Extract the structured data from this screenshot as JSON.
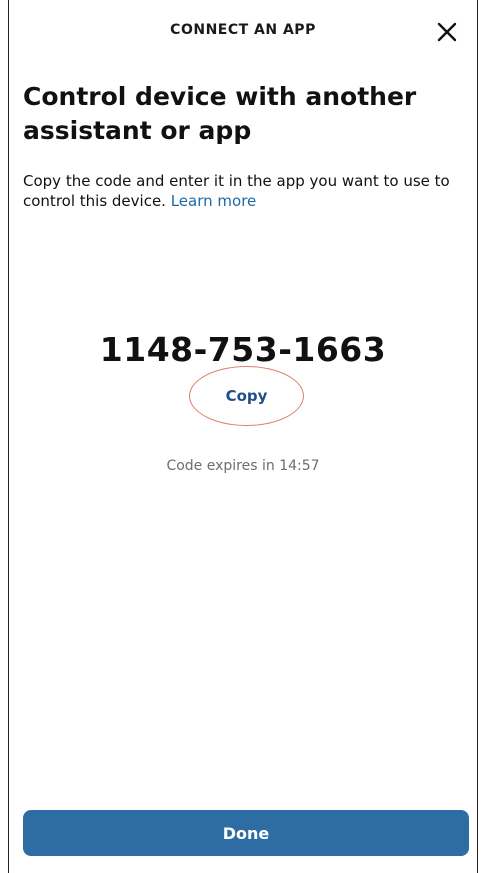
{
  "header": {
    "title": "CONNECT AN APP",
    "close_icon": "close-icon"
  },
  "main": {
    "heading": "Control device with another assistant or app",
    "description": "Copy the code and enter it in the app you want to use to control this device.",
    "learn_more": "Learn more",
    "code": "1148-753-1663",
    "copy_label": "Copy",
    "expires_text": "Code expires in 14:57"
  },
  "footer": {
    "done_label": "Done"
  },
  "colors": {
    "accent": "#2e6da4",
    "link": "#1f6aa6",
    "annotation_circle": "#d9806b"
  }
}
